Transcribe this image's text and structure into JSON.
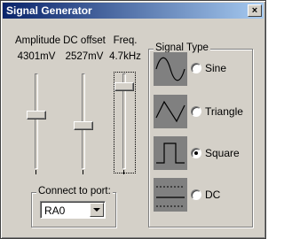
{
  "window": {
    "title": "Signal Generator",
    "close_symbol": "×"
  },
  "sliders": [
    {
      "name": "Amplitude",
      "value_text": "4301mV",
      "level": 0.57
    },
    {
      "name": "DC offset",
      "value_text": "2527mV",
      "level": 0.45
    },
    {
      "name": "Freq.",
      "value_text": "4.7kHz",
      "level": 0.9
    }
  ],
  "signal_type": {
    "title": "Signal Type",
    "options": [
      {
        "label": "Sine",
        "icon": "sine-wave-icon",
        "selected": false
      },
      {
        "label": "Triangle",
        "icon": "triangle-wave-icon",
        "selected": false
      },
      {
        "label": "Square",
        "icon": "square-wave-icon",
        "selected": true
      },
      {
        "label": "DC",
        "icon": "dc-level-icon",
        "selected": false
      }
    ]
  },
  "port": {
    "title": "Connect to port:",
    "selected": "RA0"
  },
  "colors": {
    "titlebar_start": "#0a246a",
    "titlebar_end": "#a6caf0",
    "face": "#d4d0c8",
    "icon_background": "#808080"
  }
}
